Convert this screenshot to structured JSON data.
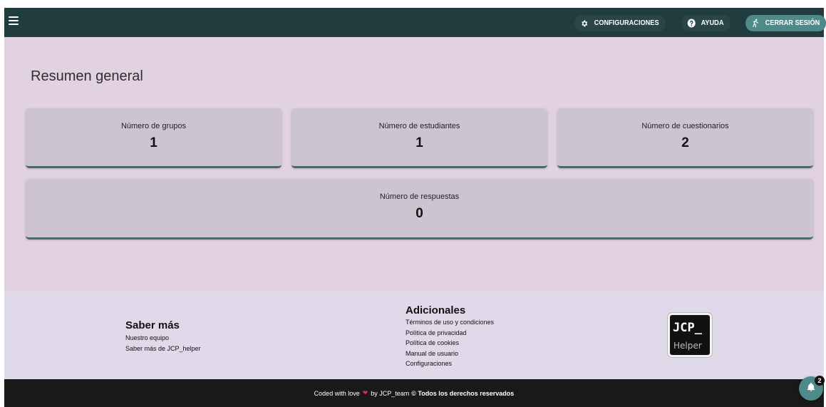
{
  "header": {
    "config_label": "CONFIGURACIONES",
    "help_label": "AYUDA",
    "logout_label": "CERRAR SESIÓN"
  },
  "main": {
    "title": "Resumen general",
    "cards": [
      {
        "label": "Número de grupos",
        "value": "1"
      },
      {
        "label": "Número de estudiantes",
        "value": "1"
      },
      {
        "label": "Número de cuestionarios",
        "value": "2"
      },
      {
        "label": "Número de respuestas",
        "value": "0"
      }
    ]
  },
  "footer": {
    "col1": {
      "title": "Saber más",
      "links": [
        "Nuestro equipo",
        "Saber más de JCP_helper"
      ]
    },
    "col2": {
      "title": "Adicionales",
      "links": [
        "Términos de uso y condiciones",
        "Política de privacidad",
        "Política de cookies",
        "Manual de usuario",
        "Configuraciones"
      ]
    },
    "logo": {
      "line1": "JCP_",
      "line2": "Helper"
    }
  },
  "bottom": {
    "text_before": "Coded with love",
    "text_by": "by JCP_team",
    "copyright": "© Todos los derechos reservados"
  },
  "notification": {
    "count": "2"
  },
  "colors": {
    "topbar": "#213c3e",
    "accent": "#4f8a8a",
    "main_bg": "#e1d1e1",
    "card_bg": "#cdc4d1",
    "footer_bg": "#dfd9ea",
    "bottom_bg": "#191919"
  },
  "icons": [
    "menu-icon",
    "gear-icon",
    "help-icon",
    "running-person-icon",
    "heart-icon",
    "bell-icon"
  ]
}
